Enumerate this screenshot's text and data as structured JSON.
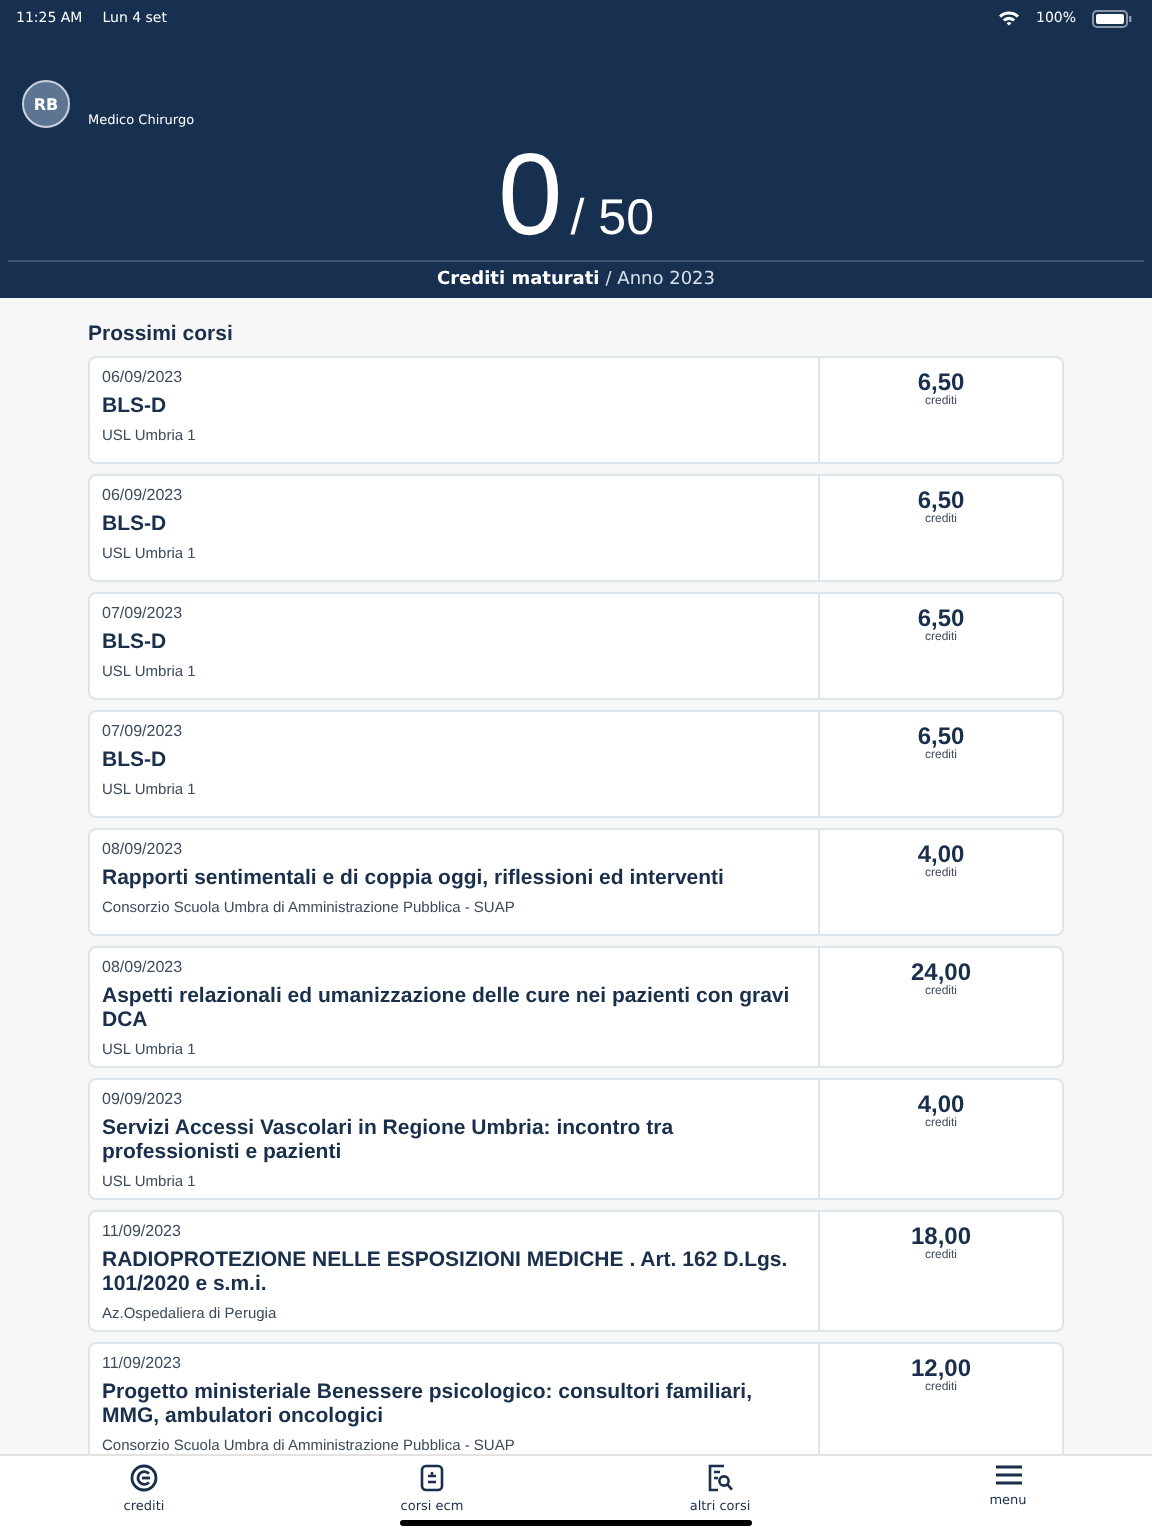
{
  "status_bar": {
    "time": "11:25 AM",
    "date": "Lun 4 set",
    "battery": "100%"
  },
  "profile": {
    "initials": "RB",
    "role": "Medico Chirurgo"
  },
  "credits": {
    "earned": "0",
    "total": "/ 50",
    "label": "Crediti maturati",
    "period": "/ Anno 2023"
  },
  "section_title": "Prossimi corsi",
  "courses": [
    {
      "date": "06/09/2023",
      "title": "BLS-D",
      "provider": "USL Umbria 1",
      "credits": "6,50",
      "unit": "crediti"
    },
    {
      "date": "06/09/2023",
      "title": "BLS-D",
      "provider": "USL Umbria 1",
      "credits": "6,50",
      "unit": "crediti"
    },
    {
      "date": "07/09/2023",
      "title": "BLS-D",
      "provider": "USL Umbria 1",
      "credits": "6,50",
      "unit": "crediti"
    },
    {
      "date": "07/09/2023",
      "title": "BLS-D",
      "provider": "USL Umbria 1",
      "credits": "6,50",
      "unit": "crediti"
    },
    {
      "date": "08/09/2023",
      "title": "Rapporti sentimentali e di coppia oggi, riflessioni ed interventi",
      "provider": "Consorzio Scuola Umbra di Amministrazione Pubblica - SUAP",
      "credits": "4,00",
      "unit": "crediti"
    },
    {
      "date": "08/09/2023",
      "title": "Aspetti relazionali ed umanizzazione delle cure nei pazienti con gravi DCA",
      "provider": "USL Umbria 1",
      "credits": "24,00",
      "unit": "crediti"
    },
    {
      "date": "09/09/2023",
      "title": "Servizi Accessi Vascolari in Regione Umbria: incontro tra professionisti e pazienti",
      "provider": "USL Umbria 1",
      "credits": "4,00",
      "unit": "crediti"
    },
    {
      "date": "11/09/2023",
      "title": "RADIOPROTEZIONE NELLE ESPOSIZIONI MEDICHE . Art. 162 D.Lgs. 101/2020 e s.m.i.",
      "provider": "Az.Ospedaliera di Perugia",
      "credits": "18,00",
      "unit": "crediti"
    },
    {
      "date": "11/09/2023",
      "title": "Progetto ministeriale Benessere psicologico: consultori familiari, MMG, ambulatori oncologici",
      "provider": "Consorzio Scuola Umbra di Amministrazione Pubblica - SUAP",
      "credits": "12,00",
      "unit": "crediti"
    }
  ],
  "tab_bar": [
    {
      "kind": "credits",
      "label": "crediti"
    },
    {
      "kind": "ecm",
      "label": "corsi ecm"
    },
    {
      "kind": "other",
      "label": "altri corsi"
    },
    {
      "kind": "menu",
      "label": "menu"
    }
  ]
}
